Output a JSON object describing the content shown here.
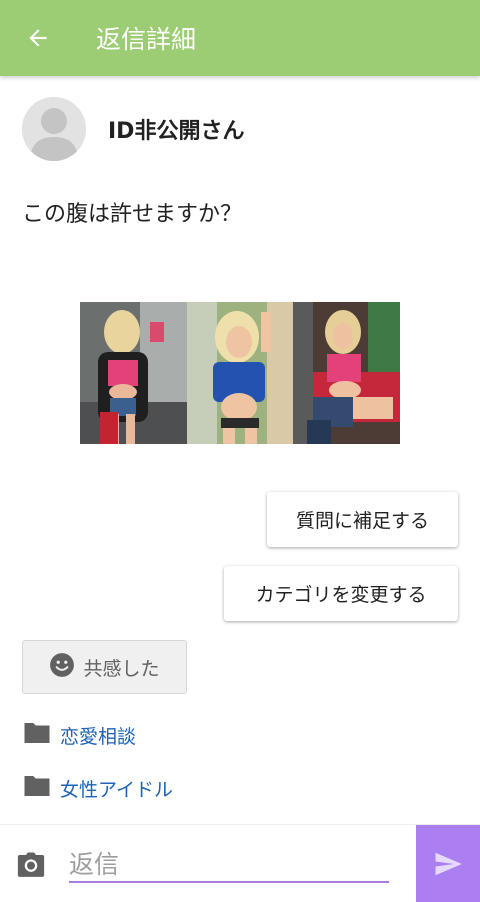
{
  "appbar": {
    "title": "返信詳細",
    "back_icon": "arrow-left-icon",
    "background": "#9ccc73"
  },
  "author": {
    "name": "ID非公開さん",
    "avatar_icon": "default-avatar-icon"
  },
  "question": {
    "text": "この腹は許せますか？"
  },
  "photos": {
    "count": 3,
    "icon": "photo-collage"
  },
  "actions": {
    "supplement_label": "質問に補足する",
    "category_label": "カテゴリを変更する"
  },
  "empathy": {
    "label": "共感した",
    "icon": "smiley-icon"
  },
  "categories": [
    {
      "label": "恋愛相談",
      "icon": "folder-icon"
    },
    {
      "label": "女性アイドル",
      "icon": "folder-icon"
    }
  ],
  "composer": {
    "placeholder": "返信",
    "camera_icon": "camera-icon",
    "send_icon": "send-icon",
    "accent": "#ab7ff0"
  }
}
